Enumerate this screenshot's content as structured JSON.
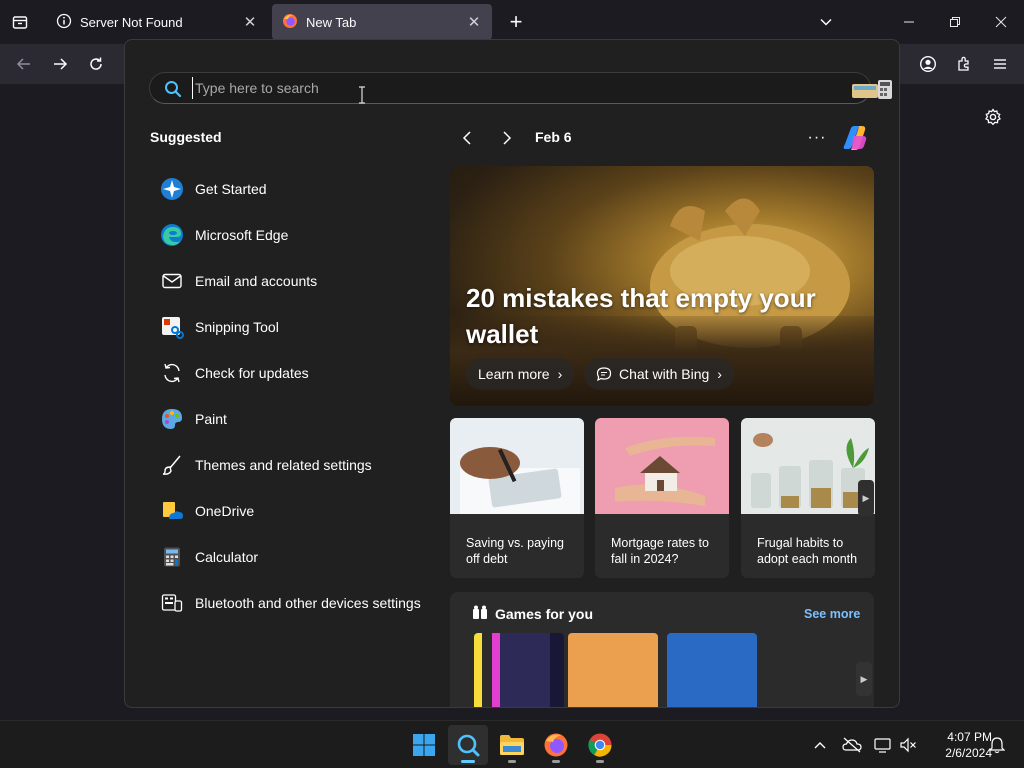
{
  "browser": {
    "tabs": [
      {
        "title": "Server Not Found",
        "active": false
      },
      {
        "title": "New Tab",
        "active": true
      }
    ],
    "new_tab_symbol": "+",
    "close_symbol": "✕"
  },
  "search_flyout": {
    "search": {
      "placeholder": "Type here to search",
      "value": ""
    },
    "suggested": {
      "title": "Suggested",
      "items": [
        {
          "label": "Get Started",
          "icon": "get-started-icon"
        },
        {
          "label": "Microsoft Edge",
          "icon": "edge-icon"
        },
        {
          "label": "Email and accounts",
          "icon": "mail-icon"
        },
        {
          "label": "Snipping Tool",
          "icon": "snipping-tool-icon"
        },
        {
          "label": "Check for updates",
          "icon": "refresh-icon"
        },
        {
          "label": "Paint",
          "icon": "paint-icon"
        },
        {
          "label": "Themes and related settings",
          "icon": "brush-icon"
        },
        {
          "label": "OneDrive",
          "icon": "onedrive-icon"
        },
        {
          "label": "Calculator",
          "icon": "calculator-icon"
        },
        {
          "label": "Bluetooth and other devices settings",
          "icon": "devices-icon"
        }
      ]
    },
    "feed": {
      "date": "Feb 6",
      "more_symbol": "···",
      "hero": {
        "title": "20 mistakes that empty your wallet",
        "buttons": [
          {
            "label": "Learn more"
          },
          {
            "label": "Chat with Bing"
          }
        ]
      },
      "cards": [
        {
          "title": "Saving vs. paying off debt"
        },
        {
          "title": "Mortgage rates to fall in 2024?"
        },
        {
          "title": "Frugal habits to adopt each month"
        }
      ],
      "games": {
        "title": "Games for you",
        "see_more": "See more"
      }
    }
  },
  "taskbar": {
    "clock": {
      "time": "4:07 PM",
      "date": "2/6/2024"
    }
  },
  "colors": {
    "accent": "#60cdff",
    "link": "#7bc0ff",
    "flyout_bg": "#202020",
    "card_bg": "#2b2b2b"
  }
}
